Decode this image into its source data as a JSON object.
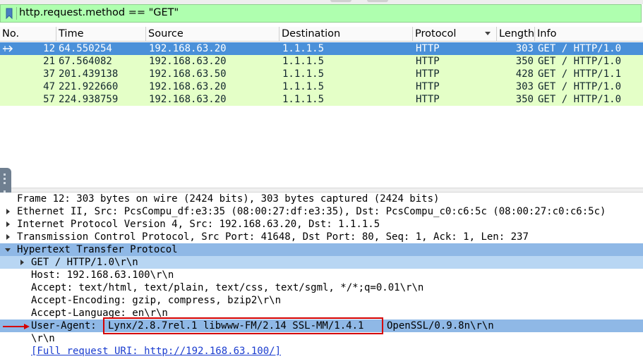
{
  "filter": {
    "expression": "http.request.method == \"GET\"",
    "bookmark_icon": "bookmark-icon",
    "background": "#afffaf"
  },
  "packet_list": {
    "columns": [
      "No.",
      "Time",
      "Source",
      "Destination",
      "Protocol",
      "Length",
      "Info"
    ],
    "sorted_column": "Protocol",
    "rows": [
      {
        "no": "12",
        "time": "64.550254",
        "source": "192.168.63.20",
        "destination": "1.1.1.5",
        "protocol": "HTTP",
        "length": "303",
        "info": "GET / HTTP/1.0",
        "selected": true
      },
      {
        "no": "21",
        "time": "67.564082",
        "source": "192.168.63.20",
        "destination": "1.1.1.5",
        "protocol": "HTTP",
        "length": "350",
        "info": "GET / HTTP/1.0",
        "selected": false
      },
      {
        "no": "37",
        "time": "201.439138",
        "source": "192.168.63.50",
        "destination": "1.1.1.5",
        "protocol": "HTTP",
        "length": "428",
        "info": "GET / HTTP/1.1",
        "selected": false
      },
      {
        "no": "47",
        "time": "221.922660",
        "source": "192.168.63.20",
        "destination": "1.1.1.5",
        "protocol": "HTTP",
        "length": "303",
        "info": "GET / HTTP/1.0",
        "selected": false
      },
      {
        "no": "57",
        "time": "224.938759",
        "source": "192.168.63.20",
        "destination": "1.1.1.5",
        "protocol": "HTTP",
        "length": "350",
        "info": "GET / HTTP/1.0",
        "selected": false
      }
    ],
    "colors": {
      "selected_row": "#4a90d9",
      "http_row": "#e4ffc7"
    }
  },
  "details": {
    "frame": "Frame 12: 303 bytes on wire (2424 bits), 303 bytes captured (2424 bits)",
    "ethernet": "Ethernet II, Src: PcsCompu_df:e3:35 (08:00:27:df:e3:35), Dst: PcsCompu_c0:c6:5c (08:00:27:c0:c6:5c)",
    "ip": "Internet Protocol Version 4, Src: 192.168.63.20, Dst: 1.1.1.5",
    "tcp": "Transmission Control Protocol, Src Port: 41648, Dst Port: 80, Seq: 1, Ack: 1, Len: 237",
    "http": "Hypertext Transfer Protocol",
    "request_line": "GET / HTTP/1.0\\r\\n",
    "host": "Host: 192.168.63.100\\r\\n",
    "accept": "Accept: text/html, text/plain, text/css, text/sgml, */*;q=0.01\\r\\n",
    "accept_encoding": "Accept-Encoding: gzip, compress, bzip2\\r\\n",
    "accept_language": "Accept-Language: en\\r\\n",
    "user_agent_label": "User-Agent:",
    "user_agent_highlight": "Lynx/2.8.7rel.1 libwww-FM/2.14 SSL-MM/1.4.1",
    "user_agent_rest": "OpenSSL/0.9.8n\\r\\n",
    "crlf": "\\r\\n",
    "full_uri": "[Full request URI: http://192.168.63.100/]",
    "highlight_color": "#8fb8e6",
    "annotation_color": "#d40000"
  }
}
